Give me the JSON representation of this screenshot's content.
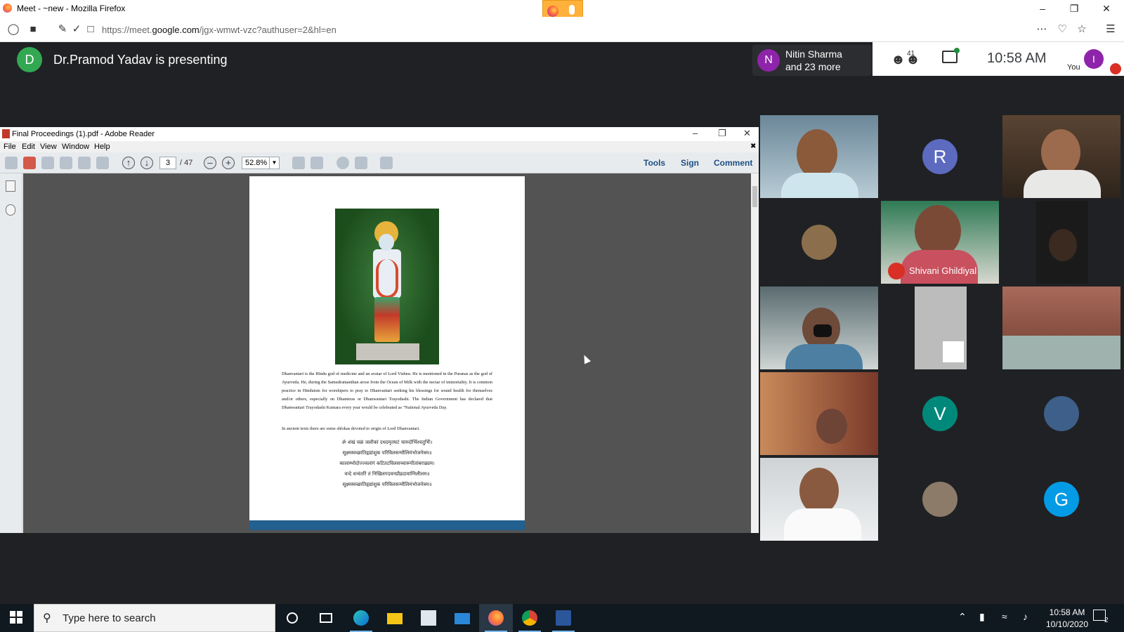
{
  "browser": {
    "window_title": "Meet - ~new - Mozilla Firefox",
    "url_prefix": "https://meet.",
    "url_domain": "google.com",
    "url_rest": "/jgx-wmwt-vzc?authuser=2&hl=en"
  },
  "meet": {
    "presenter_initial": "D",
    "presenter_text": "Dr.Pramod Yadav is presenting",
    "participant_initial": "N",
    "participant_name": "Nitin Sharma",
    "participant_more": "and 23 more",
    "people_count": "41",
    "time": "10:58 AM",
    "you_initial": "I",
    "you_label": "You"
  },
  "reader": {
    "title": "Final Proceedings (1).pdf - Adobe Reader",
    "menu": [
      "File",
      "Edit",
      "View",
      "Window",
      "Help"
    ],
    "page_current": "3",
    "page_total": "/ 47",
    "zoom": "52.8%",
    "tools_label": "Tools",
    "sign_label": "Sign",
    "comment_label": "Comment",
    "paragraph1": "Dhanvantari is the Hindu god of medicine and an avatar of Lord Vishnu. He is mentioned in the Puranas as the god of Ayurveda. He, during the Samudramanthan arose from the Ocean of Milk with the nectar of immortality. It is common practice in Hinduism for worshipers to pray to Dhanvantari seeking his blessings for sound health for themselves and/or others, especially on Dhanteras or Dhanwantari Trayodashi. The Indian Government has declared that Dhanwantari Trayodashi Kumara every year would be celebrated as \"National Ayurveda Day.",
    "paragraph2": "In ancient texts there are some shlokas devoted to origin of Lord Dhanvantari.",
    "shlokas": [
      "ॐ शंखं चक्रं जलौकां दधदमृतघटं चारुदोर्भिश्चतुर्भिः।",
      "सूक्ष्मस्वच्छातिहृद्यांशुक परिविलसन्मौलिमंभोजनेत्रम॥",
      "कालाम्भोदोज्ज्वलांगं कटितटविलसच्चारूपीतांबराढ्यम।",
      "वन्दे धन्वंतरिं तं निखिलगदवनप्रौढदावाग्निलीलम॥",
      "सूक्ष्मस्वच्छातिहृद्यांशुक परिविलसन्मौलिमंभोजनेत्रम॥"
    ]
  },
  "video_grid": {
    "tile_letters": [
      "R",
      "V",
      "G"
    ],
    "letter_colors": [
      "#5c6bc0",
      "#00897b",
      "#039be5"
    ],
    "named_participant": "Shivani Ghildiyal"
  },
  "taskbar": {
    "search_placeholder": "Type here to search",
    "time": "10:58 AM",
    "date": "10/10/2020",
    "notification_count": "2"
  }
}
